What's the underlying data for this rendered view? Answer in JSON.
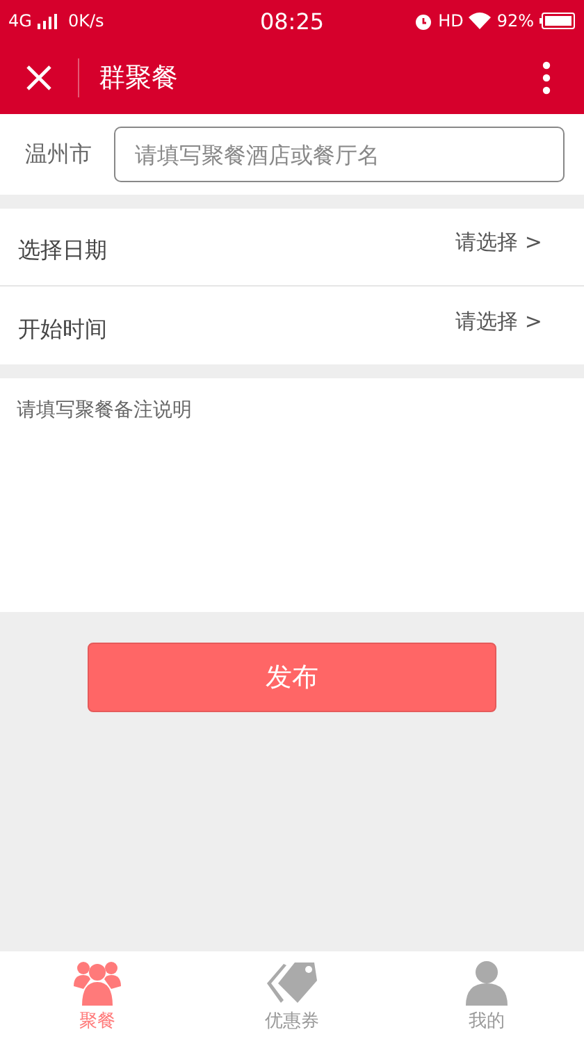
{
  "status_bar": {
    "network": "4G",
    "speed": "0K/s",
    "time": "08:25",
    "hd": "HD",
    "battery": "92%"
  },
  "header": {
    "title": "群聚餐"
  },
  "location": {
    "city": "温州市",
    "placeholder": "请填写聚餐酒店或餐厅名"
  },
  "rows": [
    {
      "label": "选择日期",
      "value": "请选择 >"
    },
    {
      "label": "开始时间",
      "value": "请选择 >"
    }
  ],
  "notes": {
    "placeholder": "请填写聚餐备注说明"
  },
  "submit": "发布",
  "tabs": [
    {
      "label": "聚餐",
      "kind": "people",
      "selected": true
    },
    {
      "label": "优惠券",
      "kind": "tag",
      "selected": false
    },
    {
      "label": "我的",
      "kind": "person",
      "selected": false
    }
  ]
}
